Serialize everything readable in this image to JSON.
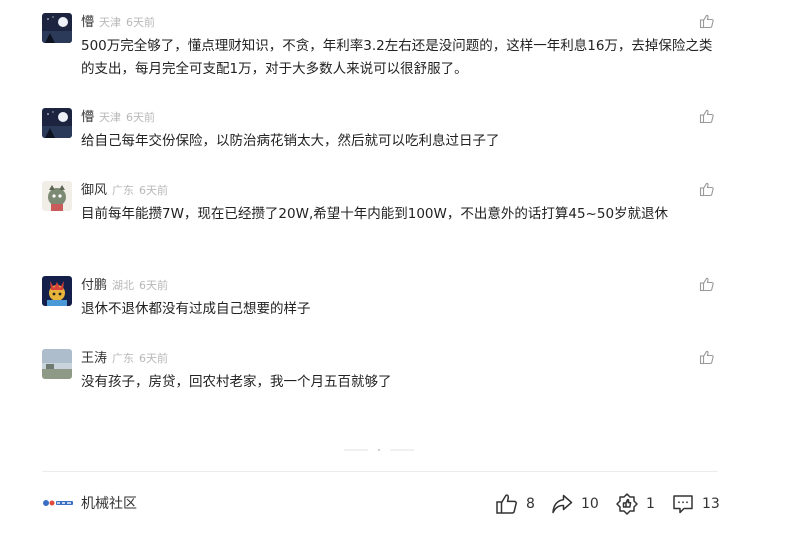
{
  "comments": [
    {
      "name": "懵",
      "location": "天津",
      "time": "6天前",
      "text": "500万完全够了，懂点理财知识，不贪，年利率3.2左右还是没问题的，这样一年利息16万，去掉保险之类的支出，每月完全可支配1万，对于大多数人来说可以很舒服了。",
      "avatar": "night-sky-avatar"
    },
    {
      "name": "懵",
      "location": "天津",
      "time": "6天前",
      "text": "给自己每年交份保险，以防治病花销太大，然后就可以吃利息过日子了",
      "avatar": "night-sky-avatar"
    },
    {
      "name": "御风",
      "location": "广东",
      "time": "6天前",
      "text": "目前每年能攒7W，现在已经攒了20W,希望十年内能到100W，不出意外的话打算45~50岁就退休",
      "avatar": "cartoon-avatar"
    },
    {
      "name": "付鹏",
      "location": "湖北",
      "time": "6天前",
      "text": "退休不退休都没有过成自己想要的样子",
      "avatar": "colorful-cartoon-avatar"
    },
    {
      "name": "王涛",
      "location": "广东",
      "time": "6天前",
      "text": "没有孩子，房贷，回农村老家，我一个月五百就够了",
      "avatar": "landscape-avatar"
    }
  ],
  "footer": {
    "brand_name": "机械社区",
    "like_count": "8",
    "share_count": "10",
    "recommend_count": "1",
    "comment_count": "13"
  },
  "colors": {
    "meta_gray": "#b8b8b8",
    "text": "#222222",
    "icon": "#333333"
  }
}
